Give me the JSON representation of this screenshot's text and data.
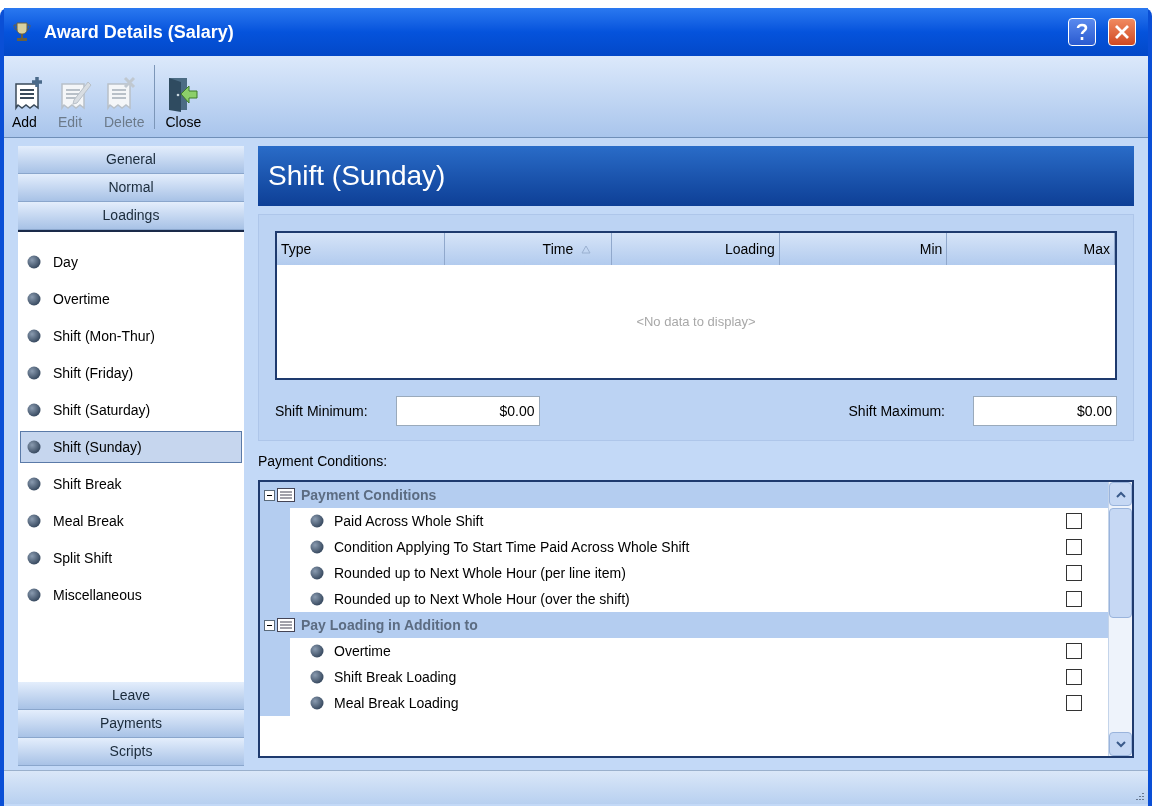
{
  "window": {
    "title": "Award Details (Salary)"
  },
  "toolbar": [
    {
      "label": "Add",
      "kind": "add",
      "disabled": false
    },
    {
      "label": "Edit",
      "kind": "edit",
      "disabled": true
    },
    {
      "label": "Delete",
      "kind": "delete",
      "disabled": true
    },
    {
      "label": "Close",
      "kind": "close",
      "disabled": false
    }
  ],
  "nav": {
    "top_sections": [
      {
        "label": "General"
      },
      {
        "label": "Normal"
      },
      {
        "label": "Loadings"
      }
    ],
    "items": [
      {
        "label": "Day",
        "selected": false
      },
      {
        "label": "Overtime",
        "selected": false
      },
      {
        "label": "Shift (Mon-Thur)",
        "selected": false
      },
      {
        "label": "Shift (Friday)",
        "selected": false
      },
      {
        "label": "Shift (Saturday)",
        "selected": false
      },
      {
        "label": "Shift (Sunday)",
        "selected": true
      },
      {
        "label": "Shift Break",
        "selected": false
      },
      {
        "label": "Meal Break",
        "selected": false
      },
      {
        "label": "Split Shift",
        "selected": false
      },
      {
        "label": "Miscellaneous",
        "selected": false
      }
    ],
    "bottom_sections": [
      {
        "label": "Leave"
      },
      {
        "label": "Payments"
      },
      {
        "label": "Scripts"
      }
    ]
  },
  "header": {
    "title": "Shift (Sunday)"
  },
  "table": {
    "columns": [
      {
        "label": "Type",
        "sorted": false
      },
      {
        "label": "Time",
        "sorted": true
      },
      {
        "label": "Loading",
        "sorted": false
      },
      {
        "label": "Min",
        "sorted": false
      },
      {
        "label": "Max",
        "sorted": false
      }
    ],
    "empty_text": "<No data to display>"
  },
  "fields": [
    {
      "label": "Shift Minimum:",
      "value": "$0.00"
    },
    {
      "label": "Shift Maximum:",
      "value": "$0.00"
    }
  ],
  "conditions": {
    "label": "Payment Conditions:",
    "groups": [
      {
        "title": "Payment Conditions",
        "expanded": true,
        "children": [
          {
            "label": "Paid Across Whole Shift",
            "checked": false
          },
          {
            "label": "Condition Applying To Start Time Paid Across Whole Shift",
            "checked": false
          },
          {
            "label": "Rounded up to Next Whole Hour (per line item)",
            "checked": false
          },
          {
            "label": "Rounded up to Next Whole Hour (over the shift)",
            "checked": false
          }
        ]
      },
      {
        "title": "Pay Loading in Addition to",
        "expanded": true,
        "children": [
          {
            "label": "Overtime",
            "checked": false
          },
          {
            "label": "Shift Break Loading",
            "checked": false
          },
          {
            "label": "Meal Break Loading",
            "checked": false
          }
        ]
      }
    ]
  }
}
